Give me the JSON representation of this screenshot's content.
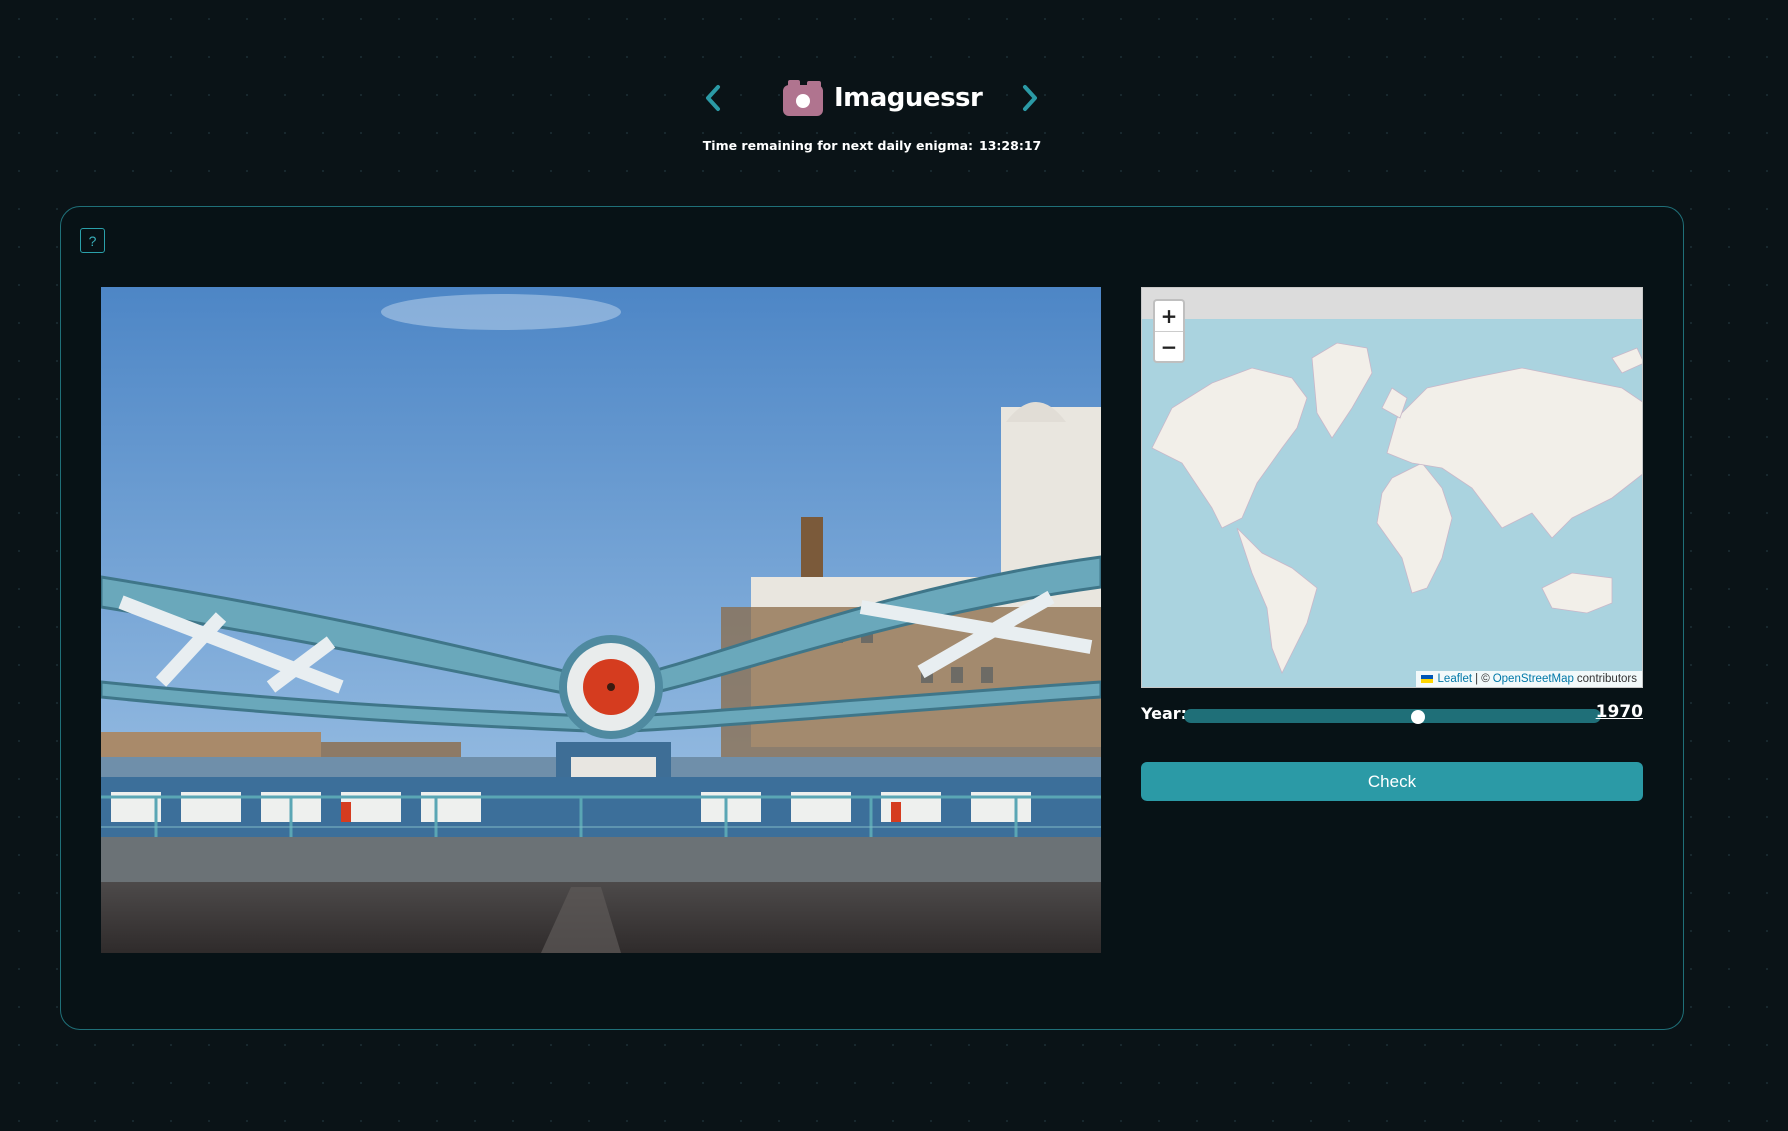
{
  "header": {
    "title": "Imaguessr",
    "prev_icon": "chevron-left-icon",
    "next_icon": "chevron-right-icon",
    "logo_icon": "camera-icon",
    "accent_color": "#2b9aa6"
  },
  "timer": {
    "label": "Time remaining for next daily enigma:",
    "value": "13:28:17"
  },
  "help": {
    "label": "?"
  },
  "photo": {
    "icon": "photo-image"
  },
  "map": {
    "zoom_in": "+",
    "zoom_out": "−",
    "attribution": {
      "leaflet": "Leaflet",
      "separator": "| ©",
      "osm": "OpenStreetMap",
      "contributors": "contributors"
    }
  },
  "year": {
    "label": "Year:",
    "value": "1970",
    "slider_fraction": 0.56
  },
  "actions": {
    "check": "Check"
  }
}
